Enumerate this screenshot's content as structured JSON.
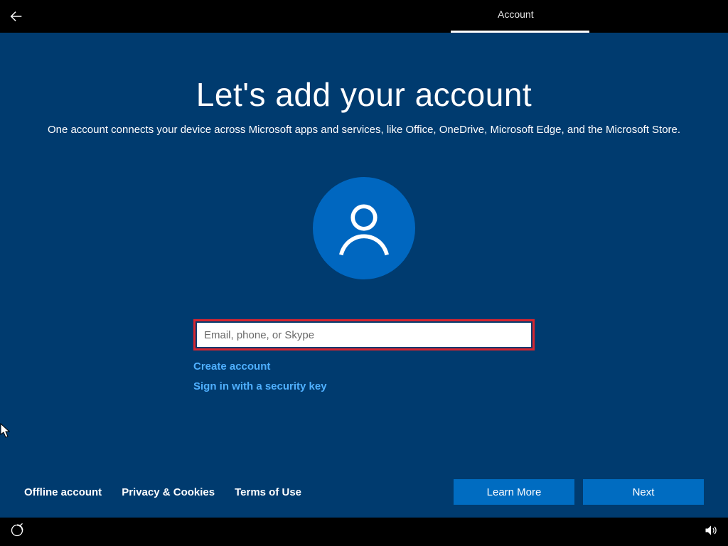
{
  "titleBar": {
    "tabLabel": "Account"
  },
  "main": {
    "heading": "Let's add your account",
    "subheading": "One account connects your device across Microsoft apps and services, like Office, OneDrive, Microsoft Edge, and the Microsoft Store."
  },
  "form": {
    "emailPlaceholder": "Email, phone, or Skype",
    "emailValue": "",
    "createAccount": "Create account",
    "securityKey": "Sign in with a security key"
  },
  "bottomLinks": {
    "offlineAccount": "Offline account",
    "privacy": "Privacy & Cookies",
    "terms": "Terms of Use"
  },
  "actions": {
    "learnMore": "Learn More",
    "next": "Next"
  },
  "colors": {
    "background": "#003b6f",
    "accent": "#006cc1",
    "highlightBorder": "#d8252f"
  }
}
